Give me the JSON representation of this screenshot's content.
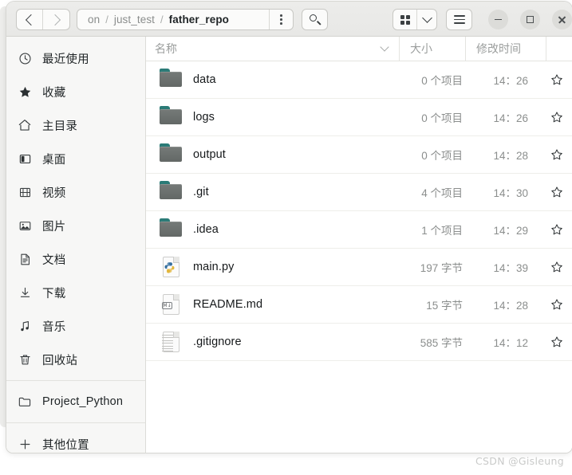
{
  "window": {
    "controls": {
      "minimize_label": "−",
      "maximize_label": "□",
      "close_label": "✕"
    }
  },
  "toolbar": {
    "back_label": "‹",
    "forward_label": "›",
    "path_menu_label": "⋮",
    "search_label": "搜索",
    "view_grid_label": "网格视图",
    "view_dropdown_label": "视图选项",
    "menu_label": "主菜单",
    "breadcrumb": [
      {
        "label": "on",
        "current": false
      },
      {
        "label": "just_test",
        "current": false
      },
      {
        "label": "father_repo",
        "current": true
      }
    ],
    "separator": "/"
  },
  "sidebar": {
    "groups": [
      {
        "items": [
          {
            "label": "最近使用",
            "icon": "clock-icon"
          },
          {
            "label": "收藏",
            "icon": "star-icon"
          },
          {
            "label": "主目录",
            "icon": "home-icon"
          },
          {
            "label": "桌面",
            "icon": "desktop-icon"
          },
          {
            "label": "视频",
            "icon": "video-icon"
          },
          {
            "label": "图片",
            "icon": "image-icon"
          },
          {
            "label": "文档",
            "icon": "document-icon"
          },
          {
            "label": "下载",
            "icon": "download-icon"
          },
          {
            "label": "音乐",
            "icon": "music-icon"
          },
          {
            "label": "回收站",
            "icon": "trash-icon"
          }
        ]
      },
      {
        "items": [
          {
            "label": "Project_Python",
            "icon": "folder-outline-icon"
          }
        ]
      },
      {
        "items": [
          {
            "label": "其他位置",
            "icon": "plus-icon"
          }
        ]
      }
    ]
  },
  "filelist": {
    "columns": {
      "name": "名称",
      "size": "大小",
      "modified": "修改时间",
      "star": ""
    },
    "rows": [
      {
        "name": "data",
        "icon": "folder-icon",
        "size": "0 个项目",
        "modified": "14：26",
        "starred": false
      },
      {
        "name": "logs",
        "icon": "folder-icon",
        "size": "0 个项目",
        "modified": "14：26",
        "starred": false
      },
      {
        "name": "output",
        "icon": "folder-icon",
        "size": "0 个项目",
        "modified": "14：28",
        "starred": false
      },
      {
        "name": ".git",
        "icon": "folder-icon",
        "size": "4 个项目",
        "modified": "14：30",
        "starred": false
      },
      {
        "name": ".idea",
        "icon": "folder-icon",
        "size": "1 个项目",
        "modified": "14：29",
        "starred": false
      },
      {
        "name": "main.py",
        "icon": "python-icon",
        "size": "197 字节",
        "modified": "14：39",
        "starred": false
      },
      {
        "name": "README.md",
        "icon": "markdown-icon",
        "size": "15 字节",
        "modified": "14：28",
        "starred": false
      },
      {
        "name": ".gitignore",
        "icon": "textfile-icon",
        "size": "585 字节",
        "modified": "14：12",
        "starred": false
      }
    ]
  },
  "watermark": {
    "text": "CSDN @Gisleung"
  },
  "colors": {
    "folder_body": "#6b6f6e",
    "folder_tab": "#2b7b77",
    "sidebar_bg": "#f7f7f6",
    "header_bg": "#ececea",
    "text_primary": "#16191b",
    "text_muted": "#8b8e8d"
  }
}
